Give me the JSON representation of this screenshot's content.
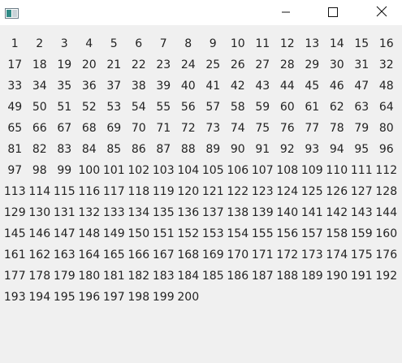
{
  "window": {
    "icon": "app-window-icon",
    "controls": {
      "minimize_icon": "minimize-icon",
      "maximize_icon": "maximize-icon",
      "close_icon": "close-icon"
    }
  },
  "numbers": [
    "1",
    "2",
    "3",
    "4",
    "5",
    "6",
    "7",
    "8",
    "9",
    "10",
    "11",
    "12",
    "13",
    "14",
    "15",
    "16",
    "17",
    "18",
    "19",
    "20",
    "21",
    "22",
    "23",
    "24",
    "25",
    "26",
    "27",
    "28",
    "29",
    "30",
    "31",
    "32",
    "33",
    "34",
    "35",
    "36",
    "37",
    "38",
    "39",
    "40",
    "41",
    "42",
    "43",
    "44",
    "45",
    "46",
    "47",
    "48",
    "49",
    "50",
    "51",
    "52",
    "53",
    "54",
    "55",
    "56",
    "57",
    "58",
    "59",
    "60",
    "61",
    "62",
    "63",
    "64",
    "65",
    "66",
    "67",
    "68",
    "69",
    "70",
    "71",
    "72",
    "73",
    "74",
    "75",
    "76",
    "77",
    "78",
    "79",
    "80",
    "81",
    "82",
    "83",
    "84",
    "85",
    "86",
    "87",
    "88",
    "89",
    "90",
    "91",
    "92",
    "93",
    "94",
    "95",
    "96",
    "97",
    "98",
    "99",
    "100",
    "101",
    "102",
    "103",
    "104",
    "105",
    "106",
    "107",
    "108",
    "109",
    "110",
    "111",
    "112",
    "113",
    "114",
    "115",
    "116",
    "117",
    "118",
    "119",
    "120",
    "121",
    "122",
    "123",
    "124",
    "125",
    "126",
    "127",
    "128",
    "129",
    "130",
    "131",
    "132",
    "133",
    "134",
    "135",
    "136",
    "137",
    "138",
    "139",
    "140",
    "141",
    "142",
    "143",
    "144",
    "145",
    "146",
    "147",
    "148",
    "149",
    "150",
    "151",
    "152",
    "153",
    "154",
    "155",
    "156",
    "157",
    "158",
    "159",
    "160",
    "161",
    "162",
    "163",
    "164",
    "165",
    "166",
    "167",
    "168",
    "169",
    "170",
    "171",
    "172",
    "173",
    "174",
    "175",
    "176",
    "177",
    "178",
    "179",
    "180",
    "181",
    "182",
    "183",
    "184",
    "185",
    "186",
    "187",
    "188",
    "189",
    "190",
    "191",
    "192",
    "193",
    "194",
    "195",
    "196",
    "197",
    "198",
    "199",
    "200"
  ]
}
